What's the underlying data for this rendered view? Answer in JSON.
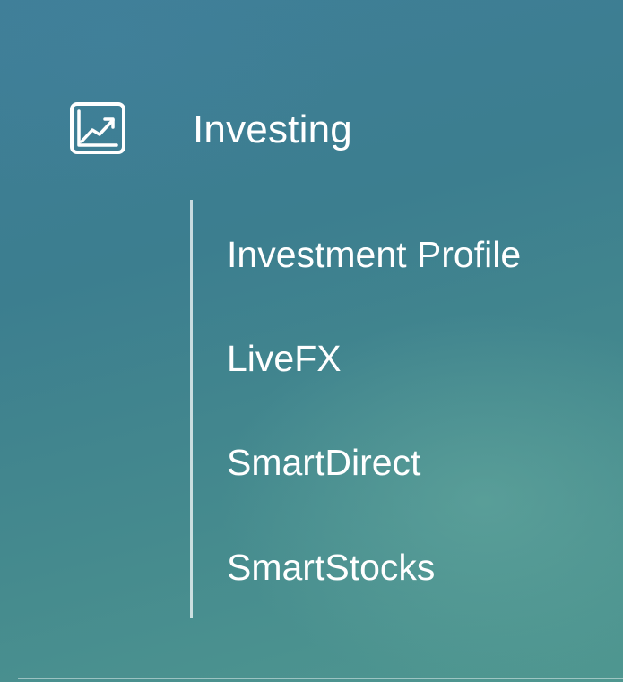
{
  "menu": {
    "section": {
      "label": "Investing",
      "icon": "trending-chart-icon",
      "items": [
        {
          "label": "Investment Profile"
        },
        {
          "label": "LiveFX"
        },
        {
          "label": "SmartDirect"
        },
        {
          "label": "SmartStocks"
        }
      ]
    }
  },
  "colors": {
    "background_top": "#3f7f98",
    "background_bottom": "#4f9790",
    "text": "#ffffff"
  }
}
